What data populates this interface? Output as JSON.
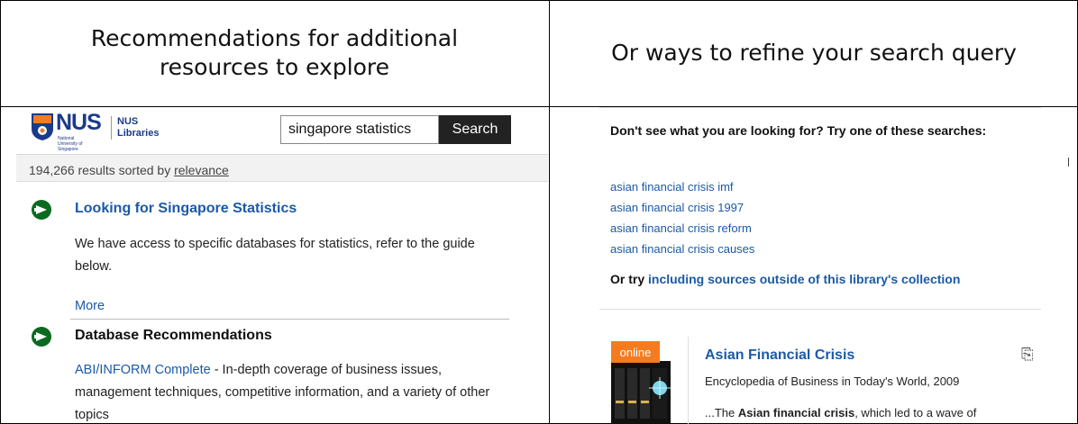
{
  "headers": {
    "left": "Recommendations for additional resources to explore",
    "right": "Or ways to refine your search query"
  },
  "left_panel": {
    "logo": {
      "word": "NUS",
      "subtitle": "National University of Singapore",
      "library_line1": "NUS",
      "library_line2": "Libraries"
    },
    "search": {
      "value": "singapore statistics",
      "button": "Search"
    },
    "results": {
      "prefix": "194,266 results sorted by ",
      "sort": "relevance"
    },
    "rec1": {
      "title": "Looking for Singapore Statistics",
      "body": "We have access to specific databases for statistics, refer to the guide below.",
      "more": "More"
    },
    "rec2": {
      "title": "Database Recommendations",
      "link": "ABI/INFORM Complete",
      "body": " - In-depth coverage of business issues, management techniques, competitive information, and a variety of other topics"
    },
    "colors": {
      "brand": "#1b3a8a",
      "link": "#1b5aa6",
      "arrow": "#0a6b1f"
    }
  },
  "right_panel": {
    "question": "Don't see what you are looking for? Try one of these searches:",
    "suggestions": [
      "asian financial crisis imf",
      "asian financial crisis 1997",
      "asian financial crisis reform",
      "asian financial crisis causes"
    ],
    "or_prefix": "Or try ",
    "or_link": "including sources outside of this library's collection",
    "result": {
      "badge": "online",
      "title": "Asian Financial Crisis",
      "source": "Encyclopedia of Business in Today's World, 2009",
      "snippet_prefix": "...The ",
      "snippet_bold": "Asian financial crisis",
      "snippet_rest": ", which led to a wave of"
    },
    "colors": {
      "badge": "#f47b20"
    }
  }
}
